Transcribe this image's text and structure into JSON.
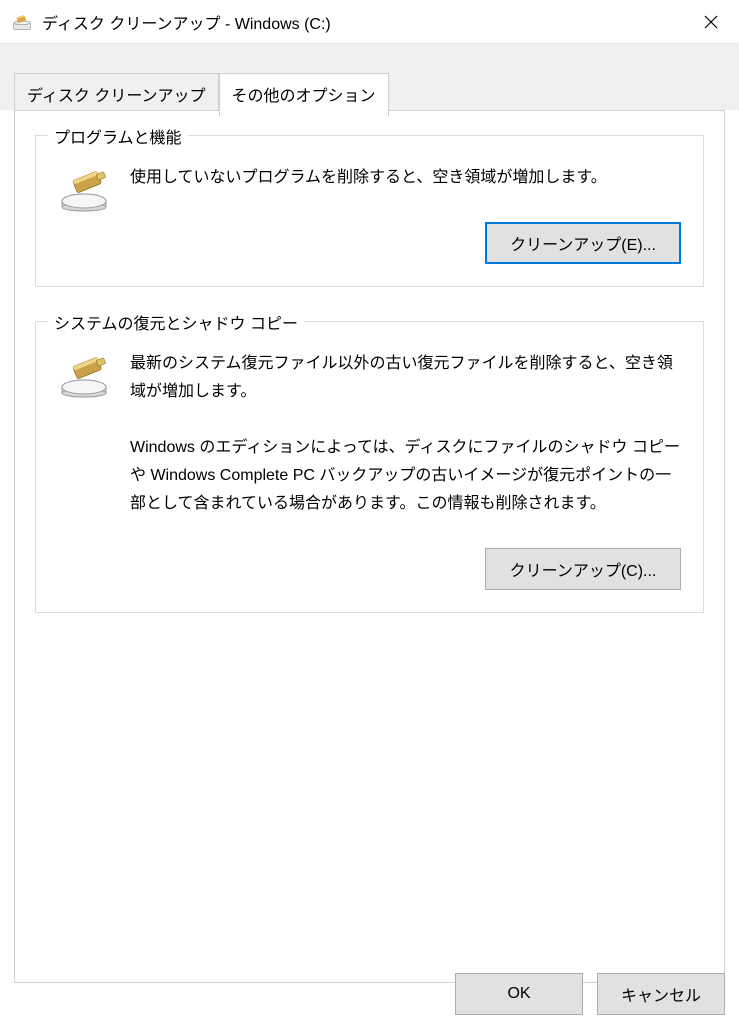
{
  "title": "ディスク クリーンアップ - Windows (C:)",
  "tabs": {
    "cleanup": "ディスク クリーンアップ",
    "more": "その他のオプション"
  },
  "group1": {
    "title": "プログラムと機能",
    "desc": "使用していないプログラムを削除すると、空き領域が増加します。",
    "button": "クリーンアップ(E)..."
  },
  "group2": {
    "title": "システムの復元とシャドウ コピー",
    "desc1": "最新のシステム復元ファイル以外の古い復元ファイルを削除すると、空き領域が増加します。",
    "desc2": "Windows のエディションによっては、ディスクにファイルのシャドウ コピーや Windows Complete PC バックアップの古いイメージが復元ポイントの一部として含まれている場合があります。この情報も削除されます。",
    "button": "クリーンアップ(C)..."
  },
  "footer": {
    "ok": "OK",
    "cancel": "キャンセル"
  }
}
